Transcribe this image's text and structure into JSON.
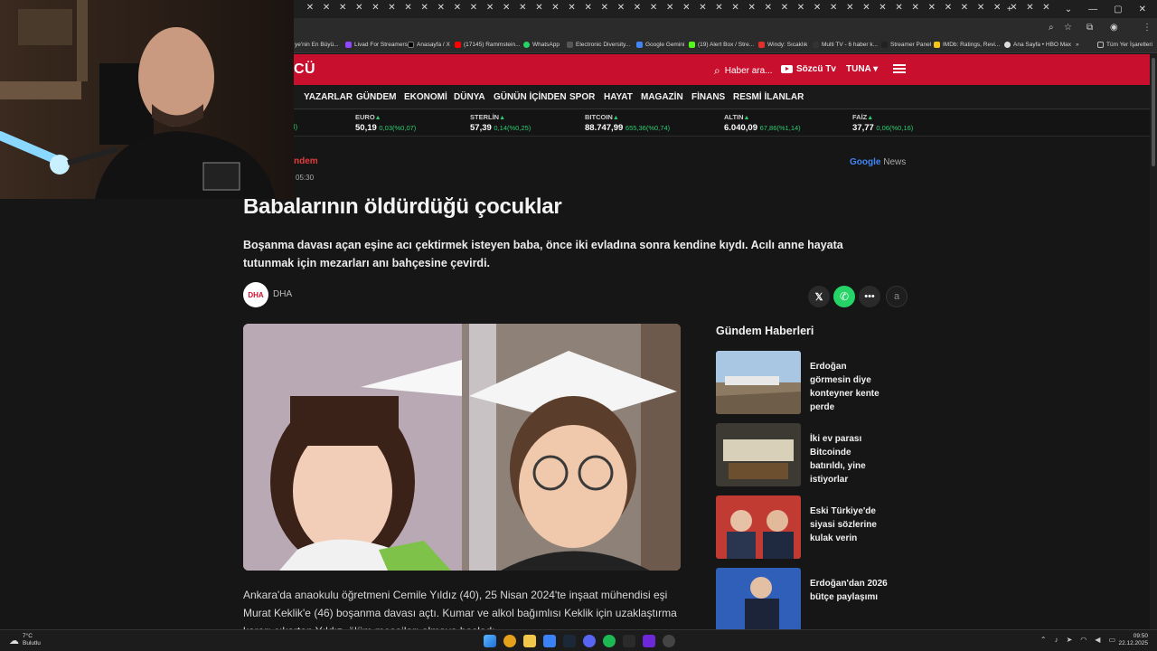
{
  "browser": {
    "bookmarks": [
      "ye'nin En Büyü...",
      "Livad For Streamers",
      "Anasayfa / X",
      "(17145) Rammstein...",
      "WhatsApp",
      "Electronic Diversity...",
      "Google Gemini",
      "(19) Alert Box / Stre...",
      "Windy: Sıcaklık",
      "Multi TV - 6 haber k...",
      "Streamer Panel",
      "IMDb: Ratings, Revi...",
      "Ana Sayfa • HBO Max",
      "»",
      "Tüm Yer İşaretleri"
    ]
  },
  "site": {
    "logo": "CÜ",
    "search_label": "Haber ara...",
    "tv_label": "Sözcü Tv",
    "user_label": "TUNA ▾",
    "nav": [
      "YAZARLAR",
      "GÜNDEM",
      "EKONOMİ",
      "DÜNYA",
      "GÜNÜN İÇİNDEN",
      "SPOR",
      "HAYAT",
      "MAGAZİN",
      "FİNANS",
      "RESMİ İLANLAR"
    ]
  },
  "ticker": [
    {
      "name": "EURO",
      "value": "50,19",
      "change": "0,03(%0,07)"
    },
    {
      "name": "STERLİN",
      "value": "57,39",
      "change": "0,14(%0,25)"
    },
    {
      "name": "BITCOIN",
      "value": "88.747,99",
      "change": "655,36(%0,74)"
    },
    {
      "name": "ALTIN",
      "value": "6.040,09",
      "change": "67,86(%1,14)"
    },
    {
      "name": "FAİZ",
      "value": "37,77",
      "change": "0,06(%0,16)"
    }
  ],
  "ticker_partial": "3)",
  "article": {
    "category": "ndem",
    "time": "05:30",
    "google_news": "News",
    "google_brand": "Google",
    "headline": "Babalarının öldürdüğü çocuklar",
    "summary": "Boşanma davası açan eşine acı çektirmek isteyen baba, önce iki evladına sonra kendine kıydı. Acılı anne hayata tutunmak için mezarları anı bahçesine çevirdi.",
    "source_logo": "DHA",
    "source_name": "DHA",
    "body": "Ankara'da anaokulu öğretmeni Cemile Yıldız (40), 25 Nisan 2024'te inşaat mühendisi eşi Murat Keklik'e (46) boşanma davası açtı. Kumar ve alkol bağımlısı Keklik için uzaklaştırma kararı çıkartan Yıldız, ölüm mesajları almaya başladı."
  },
  "sidebar": {
    "title": "Gündem Haberleri",
    "cards": [
      {
        "title": "Erdoğan görmesin diye konteyner kente perde"
      },
      {
        "title": "İki ev parası Bitcoinde batırıldı, yine istiyorlar"
      },
      {
        "title": "Eski Türkiye'de siyasi sözlerine kulak verin"
      },
      {
        "title": "Erdoğan'dan 2026 bütçe paylaşımı"
      }
    ]
  },
  "taskbar": {
    "weather_temp": "7°C",
    "weather_desc": "Bulutlu",
    "clock_time": "09:50",
    "clock_date": "22.12.2025"
  },
  "colors": {
    "brand_red": "#c8102e",
    "whatsapp": "#25d366",
    "up_green": "#2ecc71"
  }
}
